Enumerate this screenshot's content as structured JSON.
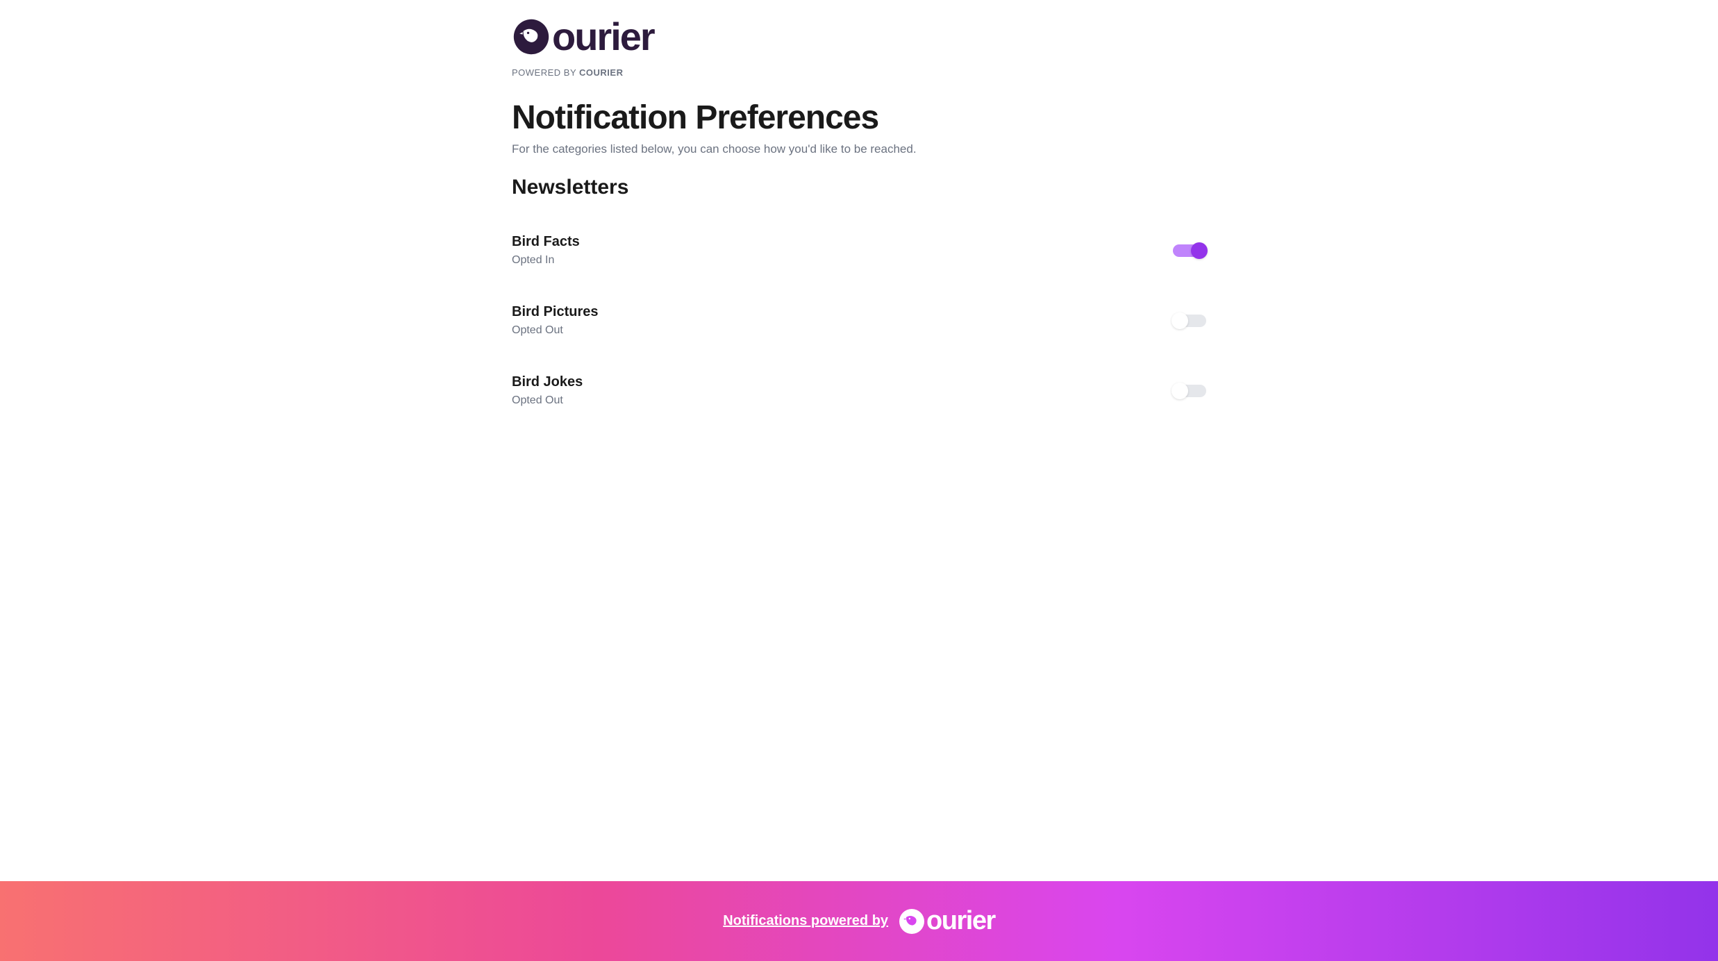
{
  "header": {
    "logo_text": "ourier",
    "powered_by_prefix": "POWERED BY ",
    "powered_by_brand": "COURIER"
  },
  "page": {
    "title": "Notification Preferences",
    "subtitle": "For the categories listed below, you can choose how you'd like to be reached."
  },
  "section": {
    "title": "Newsletters"
  },
  "preferences": [
    {
      "title": "Bird Facts",
      "status": "Opted In",
      "enabled": true
    },
    {
      "title": "Bird Pictures",
      "status": "Opted Out",
      "enabled": false
    },
    {
      "title": "Bird Jokes",
      "status": "Opted Out",
      "enabled": false
    }
  ],
  "footer": {
    "text": "Notifications powered by",
    "logo_text": "ourier"
  },
  "colors": {
    "brand_dark": "#2d1b3d",
    "accent_purple": "#9333ea",
    "accent_purple_light": "#c084fc",
    "text_muted": "#6b7280",
    "gradient_start": "#f87171",
    "gradient_end": "#9333ea"
  }
}
